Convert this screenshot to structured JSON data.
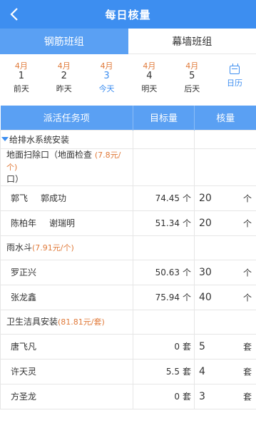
{
  "header": {
    "title": "每日核量"
  },
  "tabs": [
    {
      "label": "钢筋班组",
      "active": true
    },
    {
      "label": "幕墙班组",
      "active": false
    }
  ],
  "dates": [
    {
      "month": "4月",
      "day": "1",
      "label": "前天"
    },
    {
      "month": "4月",
      "day": "2",
      "label": "昨天"
    },
    {
      "month": "4月",
      "day": "3",
      "label": "今天",
      "today": true
    },
    {
      "month": "4月",
      "day": "4",
      "label": "明天"
    },
    {
      "month": "4月",
      "day": "5",
      "label": "后天"
    },
    {
      "label": "日历",
      "icon": "calendar-icon"
    }
  ],
  "table": {
    "headers": [
      "派活任务项",
      "目标量",
      "核量"
    ],
    "group1": {
      "name": "给排水系统安装"
    },
    "sub1": {
      "name_a": "地面扫除口（地面检查",
      "price": "(7.8元/个)",
      "name_b": "口）"
    },
    "rows1": [
      {
        "names": [
          "郭飞",
          "郭成功"
        ],
        "target": "74.45",
        "target_unit": "个",
        "qty": "20",
        "qty_unit": "个"
      },
      {
        "names": [
          "陈柏年",
          "谢瑞明"
        ],
        "target": "51.34",
        "target_unit": "个",
        "qty": "20",
        "qty_unit": "个"
      }
    ],
    "sub2": {
      "name": "雨水斗",
      "price": "(7.91元/个)"
    },
    "rows2": [
      {
        "names": [
          "罗正兴"
        ],
        "target": "50.63",
        "target_unit": "个",
        "qty": "30",
        "qty_unit": "个"
      },
      {
        "names": [
          "张龙鑫"
        ],
        "target": "75.94",
        "target_unit": "个",
        "qty": "40",
        "qty_unit": "个"
      }
    ],
    "sub3": {
      "name": "卫生洁具安装",
      "price": "(81.81元/套)"
    },
    "rows3": [
      {
        "names": [
          "唐飞凡"
        ],
        "target": "0",
        "target_unit": "套",
        "qty": "5",
        "qty_unit": "套"
      },
      {
        "names": [
          "许天灵"
        ],
        "target": "5.5",
        "target_unit": "套",
        "qty": "4",
        "qty_unit": "套"
      },
      {
        "names": [
          "方圣龙"
        ],
        "target": "0",
        "target_unit": "套",
        "qty": "3",
        "qty_unit": "套"
      }
    ]
  },
  "colors": {
    "primary": "#3d8ef0",
    "header_row": "#5aa0f3",
    "accent_orange": "#e07a3a"
  }
}
